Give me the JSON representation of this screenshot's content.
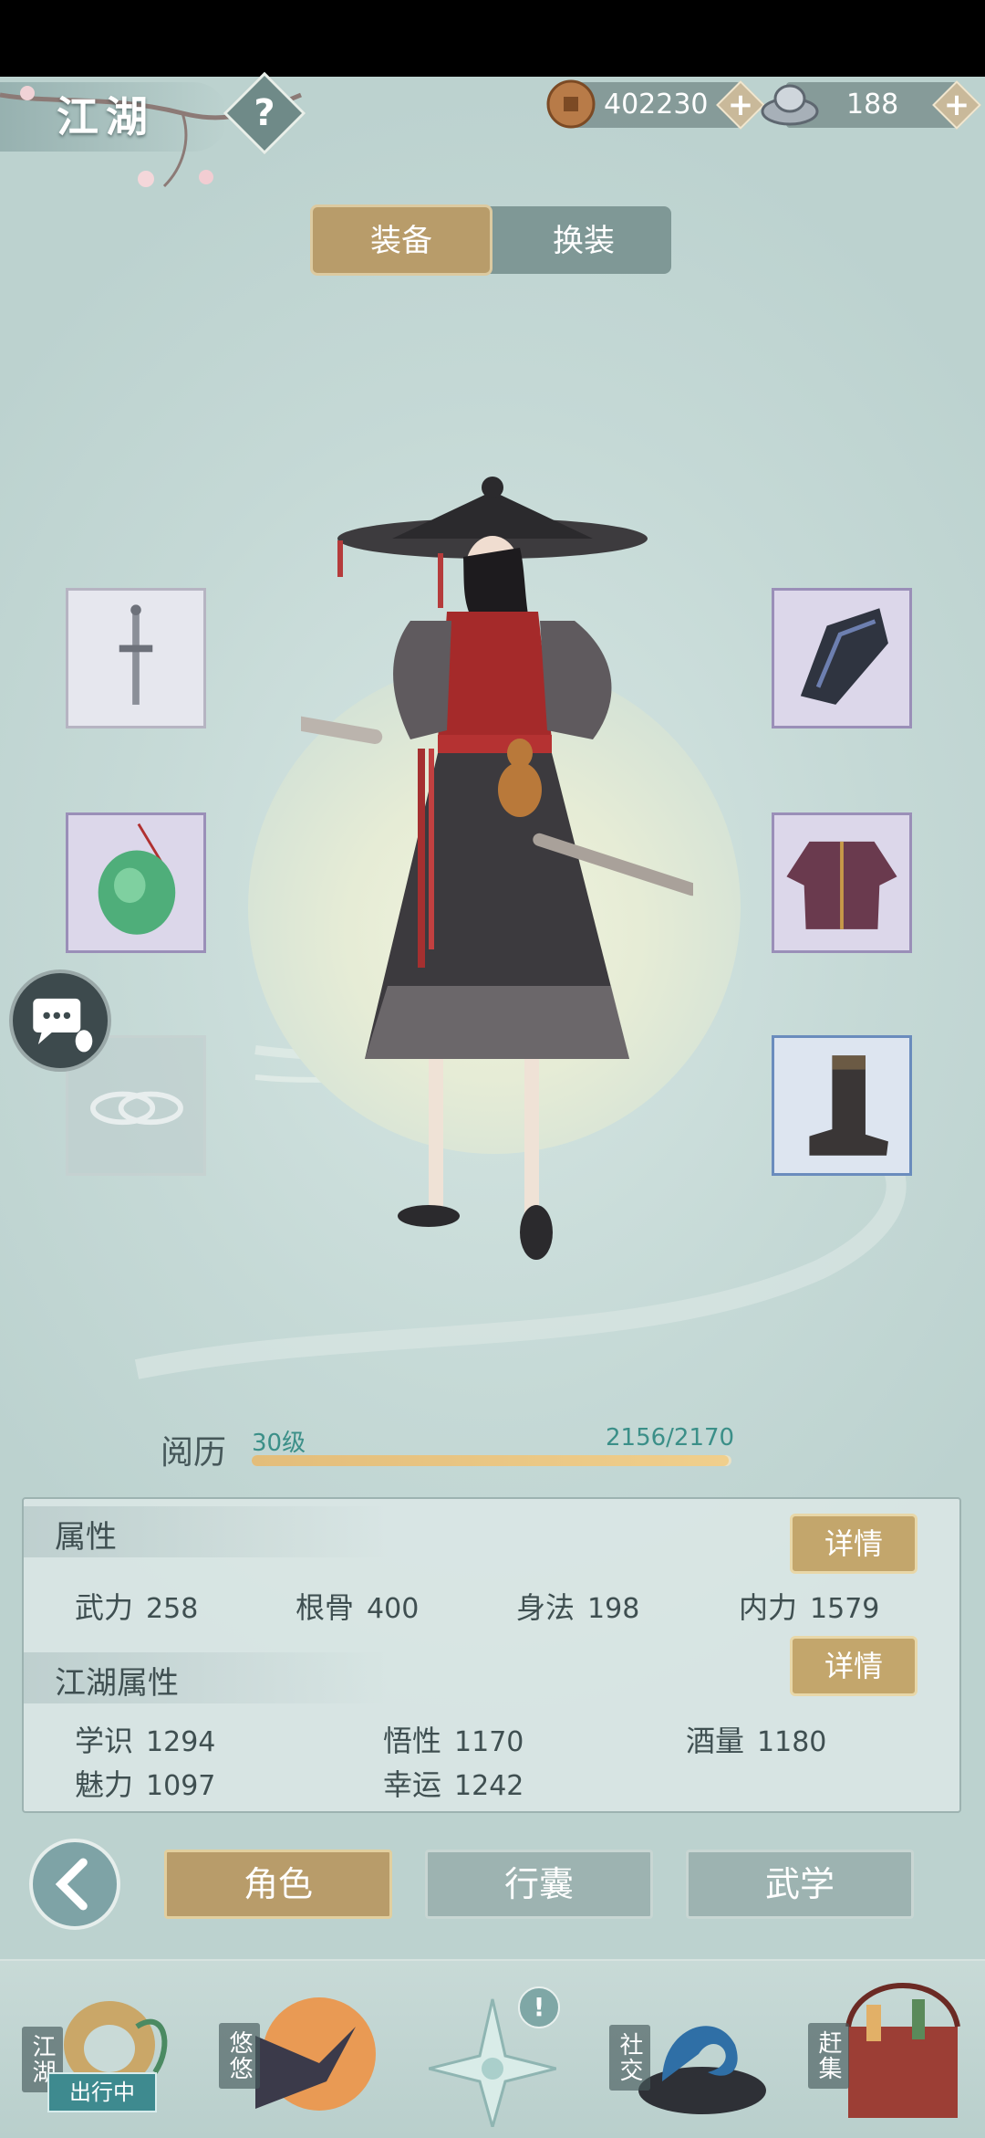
{
  "header": {
    "title": "江湖",
    "help_glyph": "?",
    "copper": {
      "icon": "copper-coin-icon",
      "amount": "402230",
      "plus": "+"
    },
    "silver": {
      "icon": "silver-ingot-icon",
      "amount": "188",
      "plus": "+"
    }
  },
  "tabs": {
    "equip": "装备",
    "outfit": "换装",
    "active": "装备"
  },
  "equipment": {
    "left": [
      {
        "name": "sword",
        "icon": "sword-icon",
        "rarity": "white"
      },
      {
        "name": "jade-pendant",
        "icon": "jade-pendant-icon",
        "rarity": "purple"
      },
      {
        "name": "ring",
        "icon": "ring-icon",
        "rarity": "empty"
      }
    ],
    "right": [
      {
        "name": "bracer",
        "icon": "bracer-icon",
        "rarity": "purple"
      },
      {
        "name": "robe",
        "icon": "robe-icon",
        "rarity": "purple"
      },
      {
        "name": "boots",
        "icon": "boots-icon",
        "rarity": "blue"
      }
    ]
  },
  "experience": {
    "label": "阅历",
    "level": "30级",
    "progress": "2156/2170",
    "current": 2156,
    "max": 2170
  },
  "attributes": {
    "title": "属性",
    "detail": "详情",
    "stats": [
      {
        "label": "武力",
        "value": "258"
      },
      {
        "label": "根骨",
        "value": "400"
      },
      {
        "label": "身法",
        "value": "198"
      },
      {
        "label": "内力",
        "value": "1579"
      }
    ]
  },
  "jianghu_attributes": {
    "title": "江湖属性",
    "detail": "详情",
    "stats": [
      {
        "label": "学识",
        "value": "1294"
      },
      {
        "label": "悟性",
        "value": "1170"
      },
      {
        "label": "酒量",
        "value": "1180"
      },
      {
        "label": "魅力",
        "value": "1097"
      },
      {
        "label": "幸运",
        "value": "1242"
      }
    ]
  },
  "bottom_tabs": {
    "role": "角色",
    "bag": "行囊",
    "martial": "武学",
    "active": "角色"
  },
  "nav": {
    "jianghu": "江湖",
    "jianghu_badge": "出行中",
    "youyou": "悠悠",
    "social": "社交",
    "market": "赶集",
    "alert": "!"
  },
  "colors": {
    "accent_gold": "#b89c6a",
    "panel_teal": "#9db3b1",
    "exp_green": "#3b8f88"
  }
}
